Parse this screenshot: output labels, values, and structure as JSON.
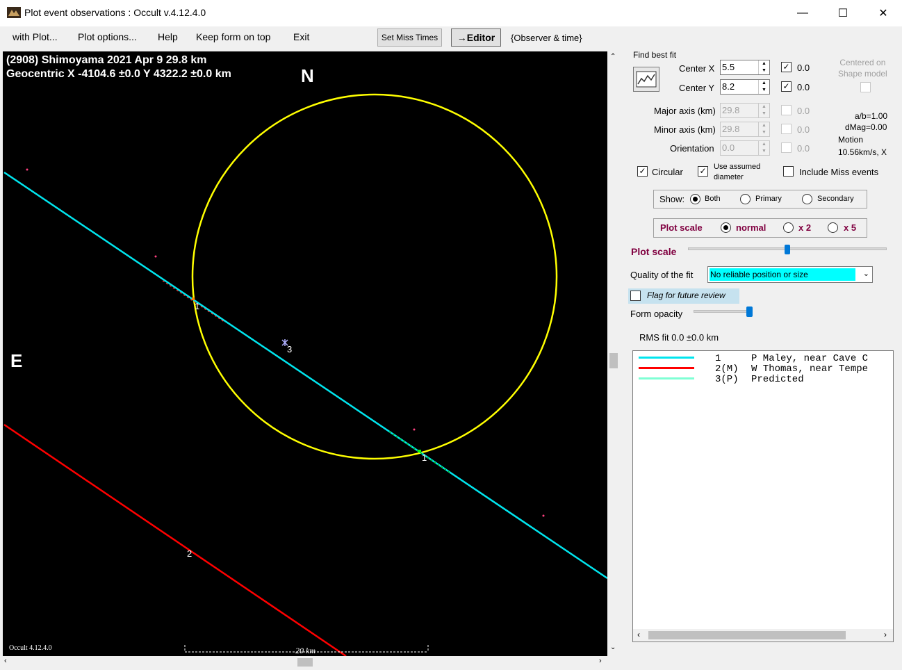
{
  "window": {
    "title": "Plot event observations : Occult v.4.12.4.0",
    "minimize_glyph": "—",
    "maximize_glyph": "☐",
    "close_glyph": "✕"
  },
  "menu": {
    "items": [
      "with Plot...",
      "Plot options...",
      "Help",
      "Keep form on top",
      "Exit"
    ],
    "set_miss_times": "Set Miss Times",
    "editor": "→Editor",
    "observer_time": "{Observer & time}"
  },
  "plot": {
    "header_line1": "(2908) Shimoyama  2021 Apr 9   29.8 km",
    "header_line2": "Geocentric  X  -4104.6 ±0.0  Y 4322.2 ±0.0 km",
    "north": "N",
    "east": "E",
    "version": "Occult 4.12.4.0",
    "scale_label": "20 km",
    "chord_labels": [
      "1",
      "1",
      "3",
      "2"
    ],
    "colors": {
      "background": "#000000",
      "ellipse": "#ffff00",
      "chord1": "#00e5ee",
      "chord2": "#ff0000",
      "predicted": "#7fffd4"
    }
  },
  "panel": {
    "find_best_fit": "Find best fit",
    "center_x_label": "Center X",
    "center_x": "5.5",
    "center_x_check": "0.0",
    "center_y_label": "Center Y",
    "center_y": "8.2",
    "center_y_check": "0.0",
    "centered_on_shape": "Centered on\nShape model",
    "major_axis_label": "Major axis (km)",
    "major_axis": "29.8",
    "major_check": "0.0",
    "minor_axis_label": "Minor axis (km)",
    "minor_axis": "29.8",
    "minor_check": "0.0",
    "orientation_label": "Orientation",
    "orientation": "0.0",
    "orientation_check": "0.0",
    "ab_ratio": "a/b=1.00",
    "dmag": "dMag=0.00",
    "motion_label": "Motion",
    "motion_value": "10.56km/s, X",
    "circular": "Circular",
    "use_assumed": "Use assumed\ndiameter",
    "include_miss": "Include Miss events",
    "show_label": "Show:",
    "show_options": [
      "Both",
      "Primary",
      "Secondary"
    ],
    "plot_scale_group": "Plot scale",
    "scale_options": [
      "normal",
      "x 2",
      "x 5"
    ],
    "plot_scale_slider_label": "Plot scale",
    "quality_label": "Quality of the fit",
    "quality_value": "No reliable position or size",
    "flag_review": "Flag for future review",
    "form_opacity": "Form opacity",
    "rms_fit": "RMS fit 0.0 ±0.0 km"
  },
  "legend": [
    {
      "num": "1   ",
      "name": "P Maley, near Cave C",
      "color": "#00e5ee"
    },
    {
      "num": "2(M)",
      "name": "W Thomas, near Tempe",
      "color": "#ff0000"
    },
    {
      "num": "3(P)",
      "name": "Predicted",
      "color": "#7fffd4"
    }
  ]
}
